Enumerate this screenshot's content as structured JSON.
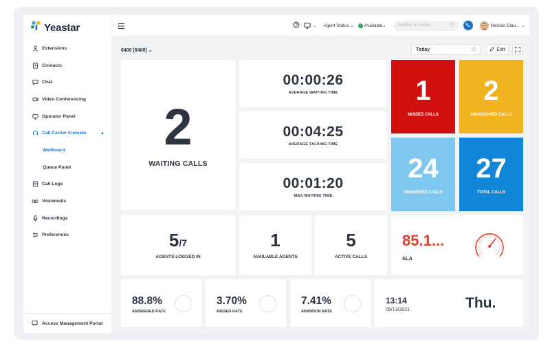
{
  "app": {
    "logo_text": "Yeastar"
  },
  "sidebar": {
    "items": [
      {
        "label": "Extensions",
        "icon": "user-icon"
      },
      {
        "label": "Contacts",
        "icon": "contacts-icon"
      },
      {
        "label": "Chat",
        "icon": "chat-icon"
      },
      {
        "label": "Video Conferencing",
        "icon": "video-icon"
      },
      {
        "label": "Operator Panel",
        "icon": "monitor-icon"
      },
      {
        "label": "Call Center Console",
        "icon": "headset-icon",
        "expanded": true
      },
      {
        "label": "Wallboard",
        "sub": true,
        "active": true
      },
      {
        "label": "Queue Panel",
        "sub": true
      },
      {
        "label": "Call Logs",
        "icon": "call-logs-icon"
      },
      {
        "label": "Voicemails",
        "icon": "voicemail-icon"
      },
      {
        "label": "Recordings",
        "icon": "microphone-icon"
      },
      {
        "label": "Preferences",
        "icon": "sliders-icon"
      }
    ],
    "footer_label": "Access Management Portal"
  },
  "topbar": {
    "agent_status_label": "Agent Status",
    "availability_label": "Available",
    "search_placeholder": "Number or Name...",
    "user_name": "Nicolas Clau..."
  },
  "toolbar": {
    "queue": "6400 [6400]",
    "date_filter": "Today",
    "edit_label": "Edit"
  },
  "wallboard": {
    "waiting_calls": {
      "value": "2",
      "label": "WAITING CALLS"
    },
    "avg_waiting": {
      "value": "00:00:26",
      "label": "AVERAGE WAITING TIME"
    },
    "avg_talking": {
      "value": "00:04:25",
      "label": "AVERAGE TALKING TIME"
    },
    "max_waiting": {
      "value": "00:01:20",
      "label": "MAX WAITING TIME"
    },
    "missed": {
      "value": "1",
      "label": "MISSED CALLS",
      "color": "#d0100f"
    },
    "abandoned": {
      "value": "2",
      "label": "ABANDONED CALLS",
      "color": "#f1b221"
    },
    "answered": {
      "value": "24",
      "label": "ANSWERED CALLS",
      "color": "#7ec8f0"
    },
    "total": {
      "value": "27",
      "label": "TOTAL CALLS",
      "color": "#1186d8"
    },
    "agents_logged_in": {
      "value": "5",
      "total": "/7",
      "label": "AGENTS LOGGED IN"
    },
    "available_agents": {
      "value": "1",
      "label": "AVAILABLE AGENTS"
    },
    "active_calls": {
      "value": "5",
      "label": "ACTIVE CALLS"
    },
    "sla": {
      "value": "85.1...",
      "label": "SLA",
      "color": "#e53a2c"
    },
    "answered_rate": {
      "value": "88.8%",
      "label": "ANSWERED RATE"
    },
    "missed_rate": {
      "value": "3.70%",
      "label": "MISSED RATE"
    },
    "abandon_rate": {
      "value": "7.41%",
      "label": "ABANDON RATE"
    },
    "clock": {
      "time": "13:14",
      "date": "05/13/2021",
      "weekday": "Thu."
    }
  }
}
